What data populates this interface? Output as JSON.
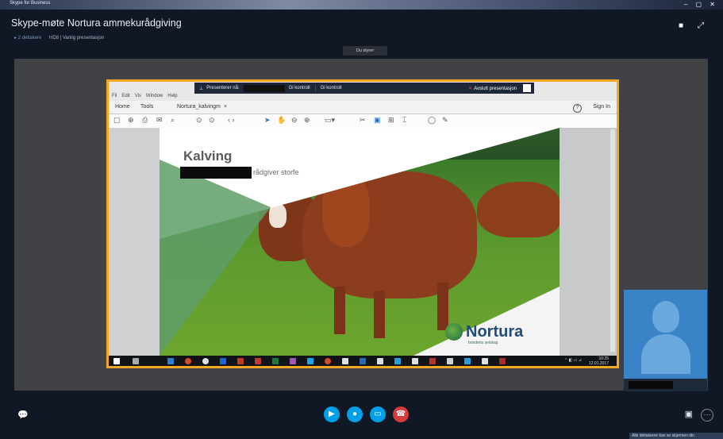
{
  "os_bar": {
    "tab_text": "Skype for Business",
    "controls": "– ▢ ✕"
  },
  "window": {
    "title": "Skype-møte Nortura ammekurådgiving",
    "subtitle_left": "▸ 2 deltakere",
    "subtitle_right": "HD8 | Vanlig presentasjon"
  },
  "banner": {
    "text": "Du styrer"
  },
  "share_toolbar": {
    "presenting_label": "Presenterer nå:",
    "request_control": "Gi kontroll",
    "give_control": "Gi kontroll",
    "stop_presenting": "Avslutt presentasjon"
  },
  "pdf_app": {
    "menu": [
      "Fil",
      "Edit",
      "Vis",
      "Window",
      "Help"
    ],
    "tabs": [
      "Home",
      "Tools",
      "Nortura_kalvingm"
    ],
    "sign_in": "Sign In",
    "tab_close": "×"
  },
  "slide": {
    "title": "Kalving",
    "subtitle_suffix": "rådgiver storfe",
    "logo_name": "Nortura",
    "logo_tagline": "bondens selskap"
  },
  "taskbar": {
    "clock": "10:25",
    "date": "12.01.2017"
  },
  "controls": {
    "chat_icon": "chat-icon",
    "video_icon": "video-icon",
    "mic_icon": "mic-icon",
    "present_icon": "present-icon",
    "hangup_icon": "hangup-icon",
    "more_label": "···"
  },
  "colors": {
    "share_border": "#f3a722",
    "video_btn": "#00a0e8",
    "hangup_btn": "#d63a3a",
    "self_bg": "#3a83c6"
  },
  "tray_notice": "Alle deltakerne kan se skjermen din"
}
